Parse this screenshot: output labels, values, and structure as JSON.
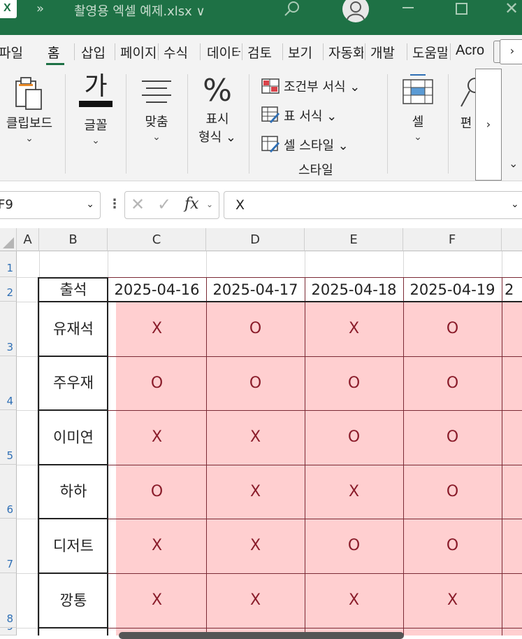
{
  "window": {
    "qat_symbol": "»",
    "title": "촬영용 엑셀 예제.xlsx ∨",
    "close_symbol": "✕"
  },
  "ribbon_tabs": [
    "파일",
    "홈",
    "삽입",
    "페이지",
    "수식",
    "데이터",
    "검토",
    "보기",
    "자동화",
    "개발",
    "도움말",
    "Acro"
  ],
  "ribbon_tab_more": "›",
  "ribbon": {
    "clipboard": "클립보드",
    "font": "글꼴",
    "font_glyph": "가",
    "alignment": "맞춤",
    "number_symbol": "%",
    "number_line1": "표시",
    "number_line2": "형식 ⌄",
    "conditional_format": "조건부 서식 ⌄",
    "format_as_table": "표 서식 ⌄",
    "cell_styles": "셀 스타일 ⌄",
    "styles_group": "스타일",
    "cells": "셀",
    "editing": "편",
    "more": "›",
    "collapse": "⌄"
  },
  "formula_bar": {
    "name_box": "F9",
    "cancel": "✕",
    "enter": "✓",
    "fx": "fx",
    "value": "X"
  },
  "columns": [
    "A",
    "B",
    "C",
    "D",
    "E",
    "F"
  ],
  "sheet": {
    "header_label": "출석",
    "dates": [
      "2025-04-16",
      "2025-04-17",
      "2025-04-18",
      "2025-04-19",
      "2"
    ],
    "names": [
      "유재석",
      "주우재",
      "이미연",
      "하하",
      "디저트",
      "깡통"
    ],
    "marks": [
      [
        "X",
        "O",
        "X",
        "O"
      ],
      [
        "O",
        "O",
        "O",
        "O"
      ],
      [
        "X",
        "X",
        "O",
        "O"
      ],
      [
        "O",
        "X",
        "X",
        "O"
      ],
      [
        "X",
        "X",
        "O",
        "O"
      ],
      [
        "X",
        "X",
        "X",
        "X"
      ]
    ]
  }
}
